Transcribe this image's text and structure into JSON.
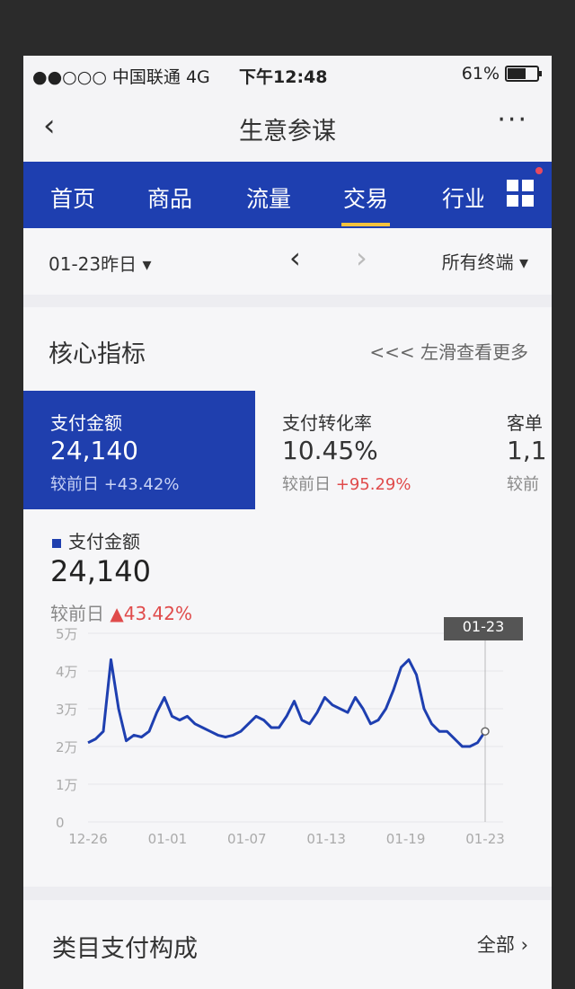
{
  "status_bar": {
    "carrier": "●●○○○ 中国联通 4G",
    "time": "下午12:48",
    "battery": "61%"
  },
  "titlebar": {
    "back": "‹",
    "title": "生意参谋",
    "more": "···"
  },
  "tabs": [
    {
      "label": "首页"
    },
    {
      "label": "商品"
    },
    {
      "label": "流量"
    },
    {
      "label": "交易",
      "active": true
    },
    {
      "label": "行业"
    }
  ],
  "datebar": {
    "date": "01-23昨日 ▾",
    "prev": "‹",
    "next": "›",
    "terminal": "所有终端 ▾"
  },
  "core": {
    "title": "核心指标",
    "hint": "<<< 左滑查看更多",
    "metrics": [
      {
        "label": "支付金额",
        "value": "24,140",
        "compare": "较前日 +43.42%",
        "selected": true
      },
      {
        "label": "支付转化率",
        "value": "10.45%",
        "compare_prefix": "较前日 ",
        "compare_pct": "+95.29%"
      },
      {
        "label": "客单",
        "value": "1,1",
        "compare": "较前"
      }
    ]
  },
  "detail": {
    "legend": "支付金额",
    "value": "24,140",
    "compare_prefix": "较前日 ",
    "compare_pct": "▲43.42%"
  },
  "chart_data": {
    "type": "line",
    "yticks": [
      "0",
      "1万",
      "2万",
      "3万",
      "4万",
      "5万"
    ],
    "ylim": [
      0,
      50000
    ],
    "xticks": [
      "12-26",
      "01-01",
      "01-07",
      "01-13",
      "01-19",
      "01-23"
    ],
    "tooltip": "01-23",
    "series": [
      {
        "values": [
          21000,
          22000,
          24000,
          43000,
          30000,
          21500,
          23000,
          22500,
          24000,
          29000,
          33000,
          28000,
          27000,
          28000,
          26000,
          25000,
          24000,
          23000,
          22500,
          23000,
          24000,
          26000,
          28000,
          27000,
          25000,
          25000,
          28000,
          32000,
          27000,
          26000,
          29000,
          33000,
          31000,
          30000,
          29000,
          33000,
          30000,
          26000,
          27000,
          30000,
          35000,
          41000,
          43000,
          39000,
          30000,
          26000,
          24000,
          24000,
          22000,
          20000,
          20000,
          21000,
          24000
        ]
      }
    ],
    "color": "#1e3fb0"
  },
  "bottom": {
    "title": "类目支付构成",
    "all": "全部 ›"
  }
}
